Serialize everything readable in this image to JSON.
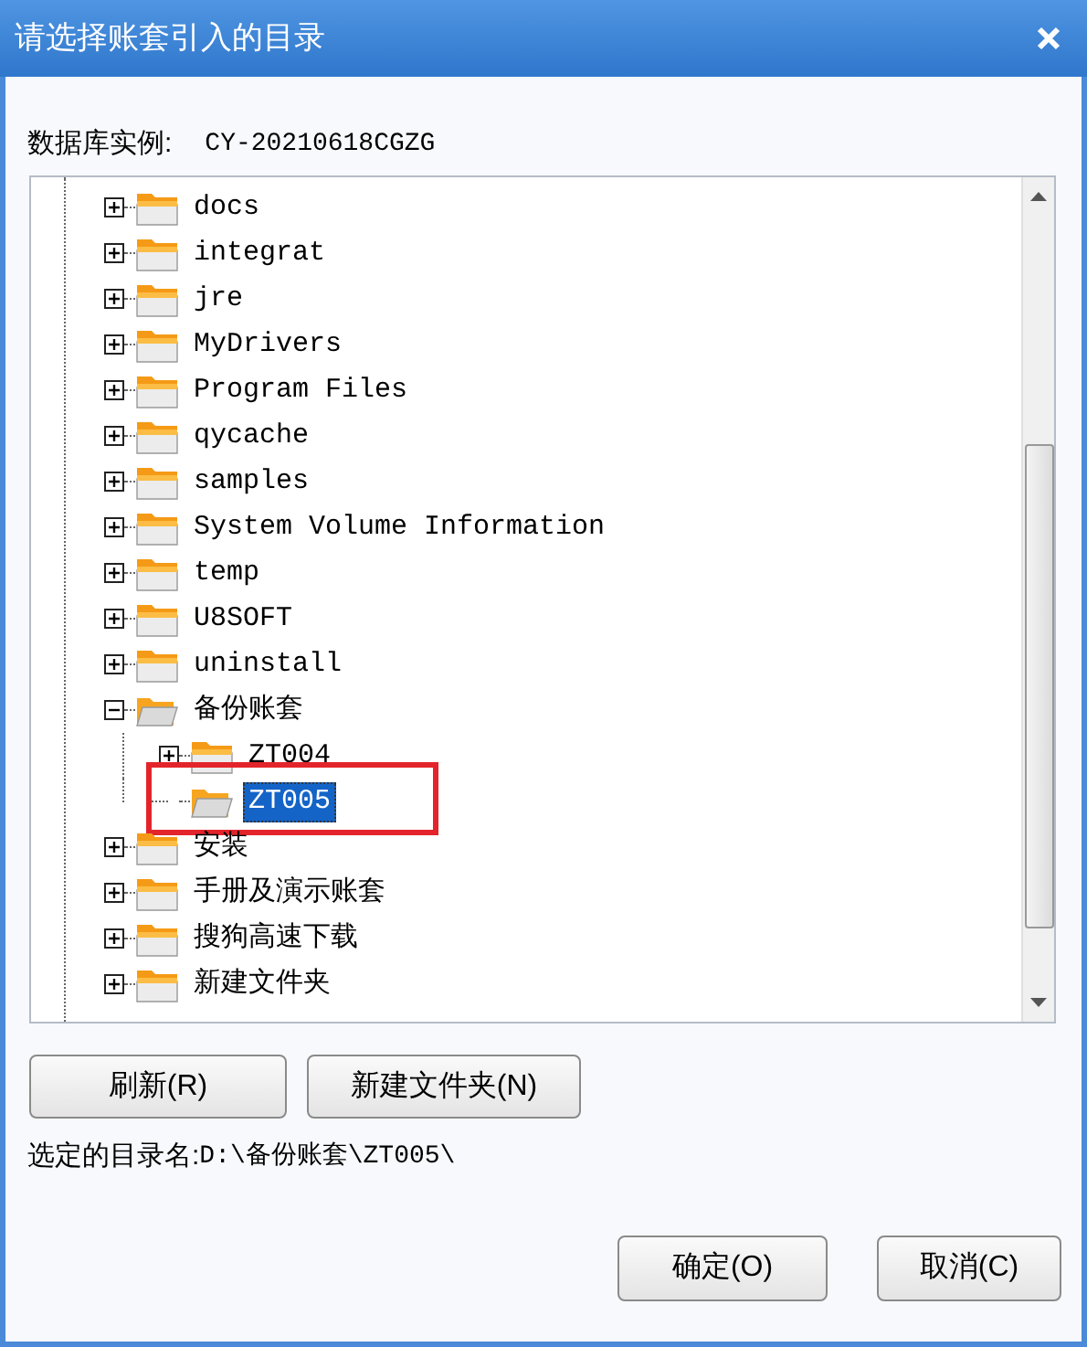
{
  "window": {
    "title": "请选择账套引入的目录"
  },
  "instance": {
    "label": "数据库实例:",
    "value": "CY-20210618CGZG"
  },
  "tree": {
    "items": [
      {
        "label": "docs",
        "expanded": false,
        "selected": false
      },
      {
        "label": "integrat",
        "expanded": false,
        "selected": false
      },
      {
        "label": "jre",
        "expanded": false,
        "selected": false
      },
      {
        "label": "MyDrivers",
        "expanded": false,
        "selected": false
      },
      {
        "label": "Program Files",
        "expanded": false,
        "selected": false
      },
      {
        "label": "qycache",
        "expanded": false,
        "selected": false
      },
      {
        "label": "samples",
        "expanded": false,
        "selected": false
      },
      {
        "label": "System Volume Information",
        "expanded": false,
        "selected": false
      },
      {
        "label": "temp",
        "expanded": false,
        "selected": false
      },
      {
        "label": "U8SOFT",
        "expanded": false,
        "selected": false
      },
      {
        "label": "uninstall",
        "expanded": false,
        "selected": false
      },
      {
        "label": "备份账套",
        "expanded": true,
        "selected": false,
        "children": [
          {
            "label": "ZT004",
            "expanded": false,
            "selected": false
          },
          {
            "label": "ZT005",
            "selected": true
          }
        ]
      },
      {
        "label": "安装",
        "expanded": false,
        "selected": false
      },
      {
        "label": "手册及演示账套",
        "expanded": false,
        "selected": false
      },
      {
        "label": "搜狗高速下载",
        "expanded": false,
        "selected": false
      },
      {
        "label": "新建文件夹",
        "expanded": false,
        "selected": false
      }
    ]
  },
  "tree_buttons": [
    "刷新(R)",
    "新建文件夹(N)"
  ],
  "selected_path": {
    "label": "选定的目录名:",
    "value": "D:\\备份账套\\ZT005\\"
  },
  "buttons": [
    "确定(O)",
    "取消(C)"
  ]
}
